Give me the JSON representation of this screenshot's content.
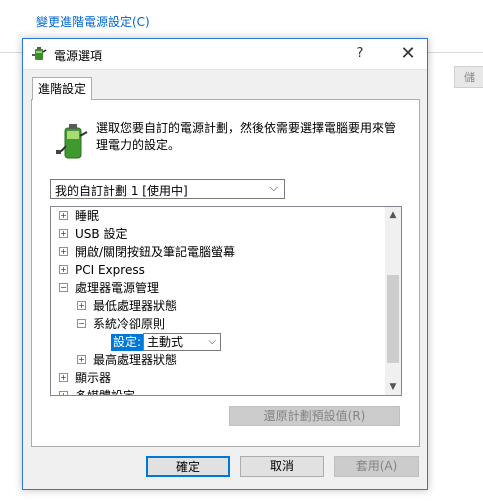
{
  "background": {
    "link_text": "變更進階電源設定(C)",
    "right_button_text": "儲"
  },
  "dialog": {
    "title": "電源選項",
    "help_label": "?",
    "close_label": "✕",
    "tab_label": "進階設定",
    "description": "選取您要自訂的電源計劃，然後依需要選擇電腦要用來管理電力的設定。",
    "plan_select": {
      "value": "我的自訂計劃 1 [使用中]"
    },
    "tree": {
      "items": [
        {
          "toggle": "+",
          "label": "睡眠"
        },
        {
          "toggle": "+",
          "label": "USB 設定"
        },
        {
          "toggle": "+",
          "label": "開啟/關閉按鈕及筆記電腦螢幕"
        },
        {
          "toggle": "+",
          "label": "PCI Express"
        },
        {
          "toggle": "−",
          "label": "處理器電源管理"
        },
        {
          "toggle": "+",
          "label": "最低處理器狀態"
        },
        {
          "toggle": "−",
          "label": "系統冷卻原則"
        },
        {
          "toggle": "+",
          "label": "最高處理器狀態"
        },
        {
          "toggle": "+",
          "label": "顯示器"
        },
        {
          "toggle": "+",
          "label": "多媒體設定"
        }
      ],
      "setting_label": "設定:",
      "setting_value": "主動式"
    },
    "restore_button": "還原計劃預設值(R)",
    "ok_button": "確定",
    "cancel_button": "取消",
    "apply_button": "套用(A)"
  },
  "colors": {
    "accent": "#0078d7",
    "link": "#0066cc",
    "dialog_border": "#2b79d3"
  }
}
